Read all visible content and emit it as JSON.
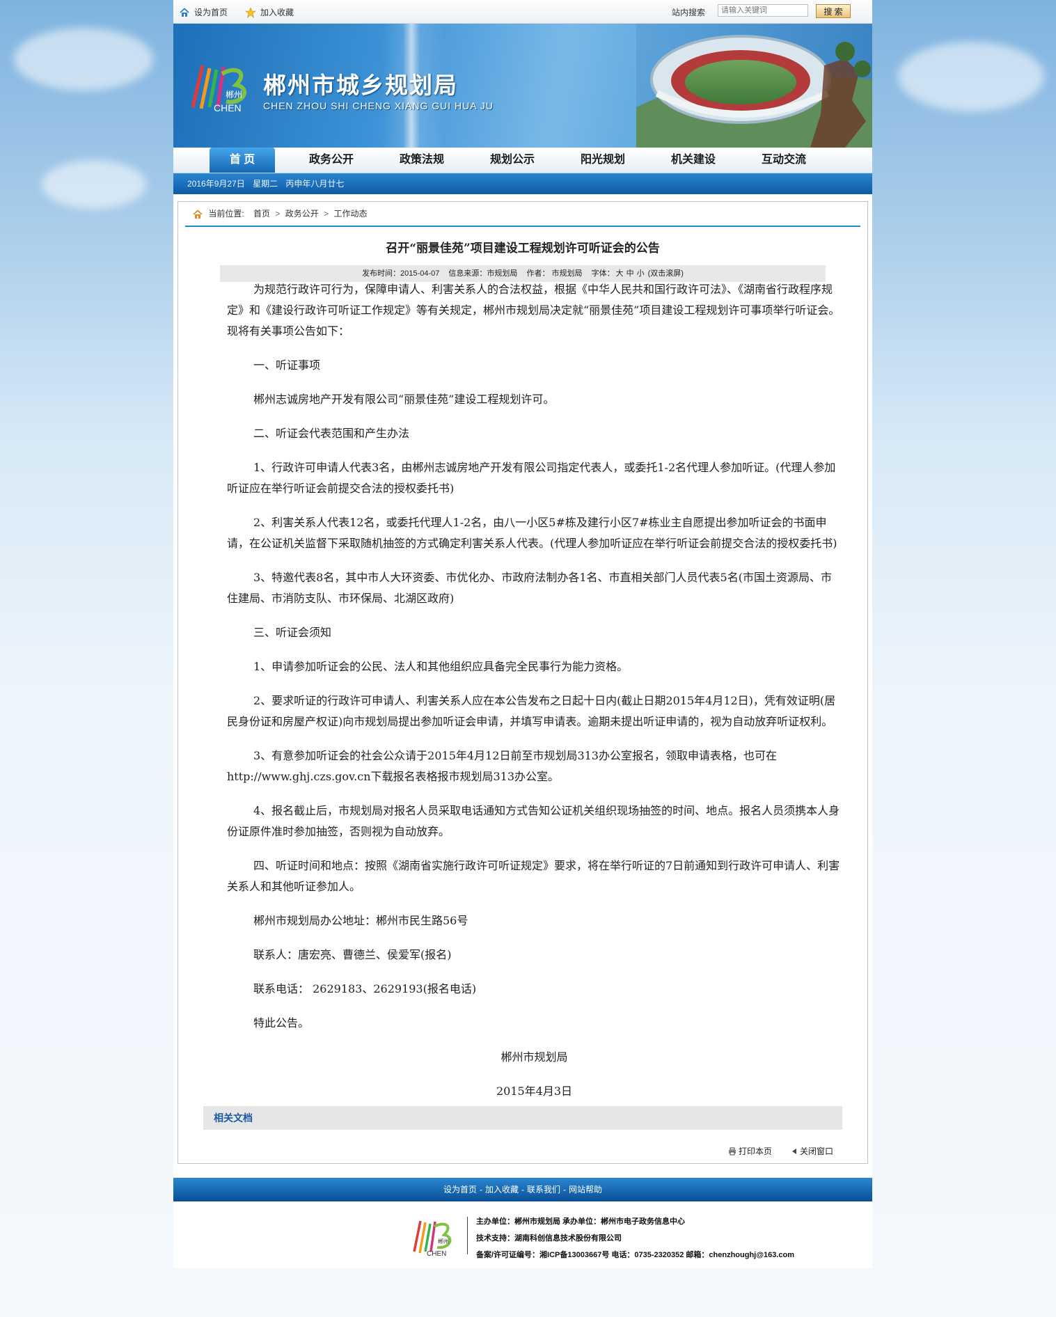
{
  "topbar": {
    "set_home": "设为首页",
    "add_favorite": "加入收藏",
    "search_label": "站内搜索",
    "search_placeholder": "请输入关键词",
    "search_button": "搜 索"
  },
  "banner": {
    "logo_text": "郴州",
    "logo_sub": "CHEN",
    "title": "郴州市城乡规划局",
    "pinyin": "CHEN ZHOU SHI CHENG XIANG GUI HUA JU"
  },
  "nav": {
    "items": [
      "首 页",
      "政务公开",
      "政策法规",
      "规划公示",
      "阳光规划",
      "机关建设",
      "互动交流"
    ]
  },
  "datebar": {
    "date": "2016年9月27日",
    "weekday": "星期二",
    "lunar": "丙申年八月廿七"
  },
  "breadcrumb": {
    "label": "当前位置:",
    "home": "首页",
    "level1": "政务公开",
    "level2": "工作动态"
  },
  "article": {
    "title": "召开“丽景佳苑”项目建设工程规划许可听证会的公告",
    "meta": {
      "publish_time": "发布时间：2015-04-07",
      "source": "信息来源：市规划局",
      "author": "作者： 市规划局",
      "font_label": "字体：",
      "size_large": "大",
      "size_medium": "中",
      "size_small": "小",
      "scroll_hint": "(双击滚屏)"
    },
    "paragraphs": [
      "为规范行政许可行为，保障申请人、利害关系人的合法权益，根据《中华人民共和国行政许可法》、《湖南省行政程序规定》和《建设行政许可听证工作规定》等有关规定，郴州市规划局决定就“丽景佳苑”项目建设工程规划许可事项举行听证会。现将有关事项公告如下：",
      "一、听证事项",
      "郴州志诚房地产开发有限公司“丽景佳苑”建设工程规划许可。",
      "二、听证会代表范围和产生办法",
      "1、行政许可申请人代表3名，由郴州志诚房地产开发有限公司指定代表人，或委托1-2名代理人参加听证。(代理人参加听证应在举行听证会前提交合法的授权委托书)",
      "2、利害关系人代表12名，或委托代理人1-2名，由八一小区5#栋及建行小区7#栋业主自愿提出参加听证会的书面申请，在公证机关监督下采取随机抽签的方式确定利害关系人代表。(代理人参加听证应在举行听证会前提交合法的授权委托书)",
      "3、特邀代表8名，其中市人大环资委、市优化办、市政府法制办各1名、市直相关部门人员代表5名(市国土资源局、市住建局、市消防支队、市环保局、北湖区政府)",
      "三、听证会须知",
      "1、申请参加听证会的公民、法人和其他组织应具备完全民事行为能力资格。",
      "2、要求听证的行政许可申请人、利害关系人应在本公告发布之日起十日内(截止日期2015年4月12日)，凭有效证明(居民身份证和房屋产权证)向市规划局提出参加听证会申请，并填写申请表。逾期未提出听证申请的，视为自动放弃听证权利。",
      "3、有意参加听证会的社会公众请于2015年4月12日前至市规划局313办公室报名，领取申请表格，也可在http://www.ghj.czs.gov.cn下载报名表格报市规划局313办公室。",
      "4、报名截止后，市规划局对报名人员采取电话通知方式告知公证机关组织现场抽签的时间、地点。报名人员须携本人身份证原件准时参加抽签，否则视为自动放弃。",
      "四、听证时间和地点：按照《湖南省实施行政许可听证规定》要求，将在举行听证的7日前通知到行政许可申请人、利害关系人和其他听证参加人。",
      "郴州市规划局办公地址：郴州市民生路56号",
      "联系人：唐宏亮、曹德兰、侯爱军(报名)",
      "联系电话： 2629183、2629193(报名电话)",
      "特此公告。"
    ],
    "signature": "郴州市规划局",
    "sign_date": "2015年4月3日"
  },
  "related": {
    "label": "相关文档"
  },
  "tools": {
    "print": "打印本页",
    "close": "关闭窗口"
  },
  "footbar": {
    "links": [
      "设为首页",
      "加入收藏",
      "联系我们",
      "网站帮助"
    ]
  },
  "footer": {
    "sponsor": "主办单位：郴州市规划局  承办单位：郴州市电子政务信息中心",
    "tech": "技术支持：湖南科创信息技术股份有限公司",
    "icp": "备案/许可证编号：湘ICP备13003667号 电话：0735-2320352 邮箱：chenzhoughj@163.com",
    "logo_text": "郴州",
    "logo_sub": "CHEN"
  },
  "colors": {
    "nav_active": "#1667b4",
    "datebar": "#0e5aa5",
    "breadcrumb_line": "#1f8ac9",
    "related_text": "#1a5aa0",
    "search_button": "#e9c47a"
  },
  "icons": [
    "home-icon",
    "star-icon",
    "print-icon",
    "close-arrow-icon"
  ]
}
